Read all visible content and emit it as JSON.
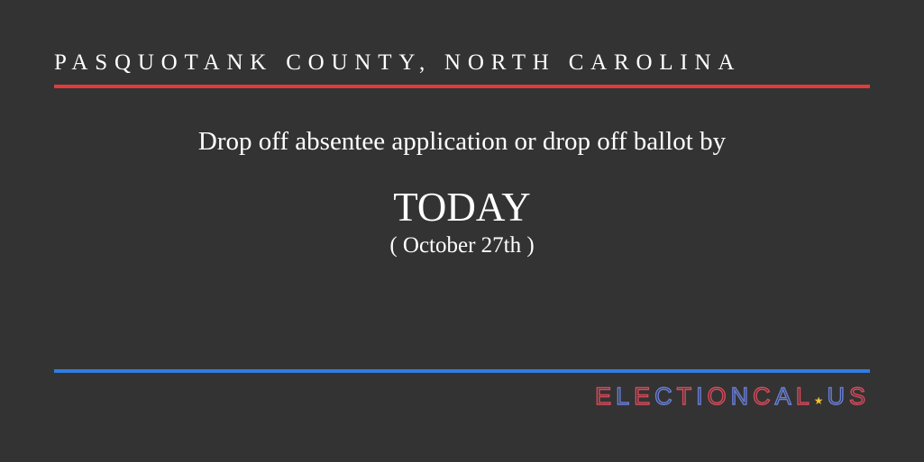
{
  "header": {
    "county": "PASQUOTANK COUNTY, NORTH CAROLINA"
  },
  "notice": {
    "instruction": "Drop off absentee application or drop off ballot by",
    "deadline": "TODAY",
    "date": "( October 27th )"
  },
  "brand": {
    "name_part1": "ELECTIONCAL",
    "star": "★",
    "name_part2": "US"
  },
  "colors": {
    "background": "#333333",
    "top_rule": "#e23b3b",
    "bottom_rule": "#2f7de1",
    "star": "#f2c230"
  }
}
